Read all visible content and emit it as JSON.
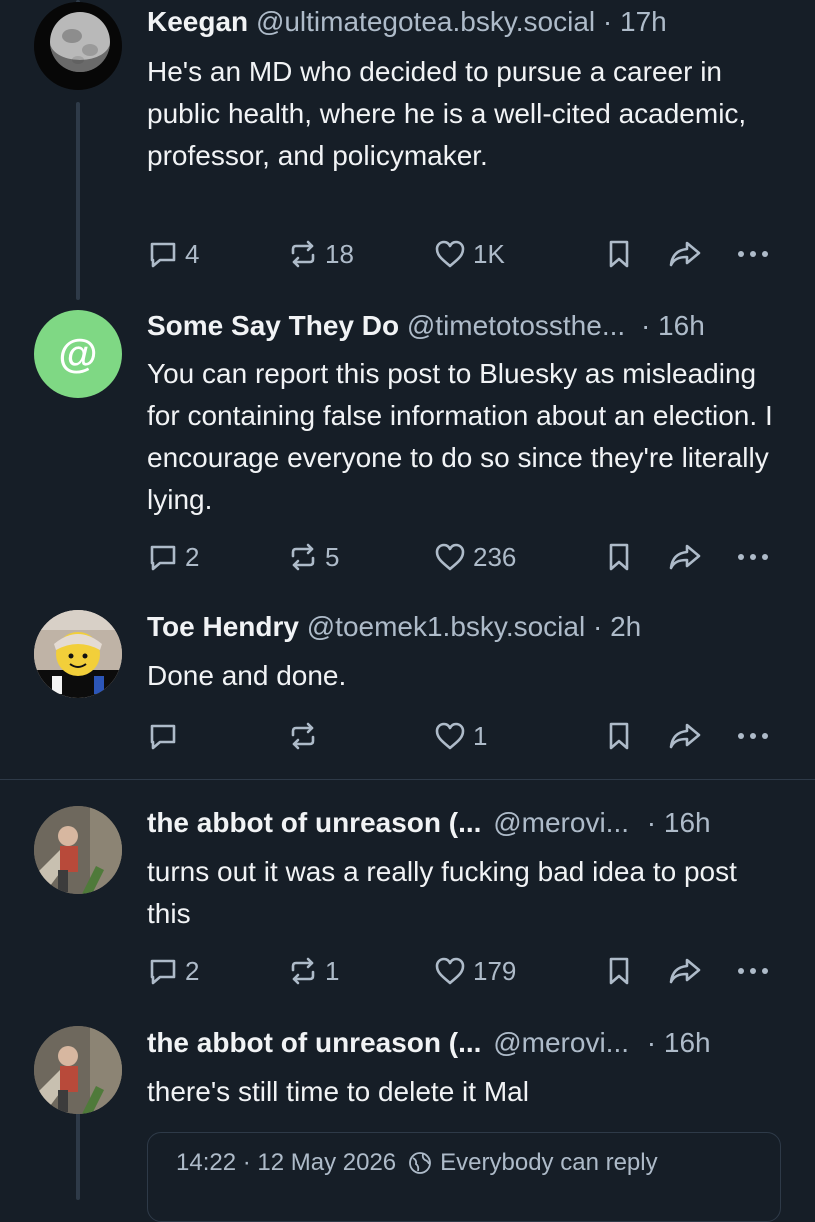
{
  "posts": [
    {
      "name": "Keegan",
      "handle": "@ultimategotea.bsky.social",
      "time": "· 17h",
      "body": "He's an MD who decided to pursue a career in public health, where he is a well-cited academic, professor, and policymaker.",
      "replies": "4",
      "reposts": "18",
      "likes": "1K"
    },
    {
      "name": "Some Say They Do",
      "handle": "@timetotossthe...",
      "time": "· 16h",
      "body": "You can report this post to Bluesky as misleading for containing false information about an election. I encourage everyone to do so since they're literally lying.",
      "replies": "2",
      "reposts": "5",
      "likes": "236",
      "avatar_glyph": "@"
    },
    {
      "name": "Toe Hendry",
      "handle": "@toemek1.bsky.social",
      "time": "· 2h",
      "body": "Done and done.",
      "replies": "",
      "reposts": "",
      "likes": "1"
    },
    {
      "name": "the abbot of unreason (...",
      "handle": "@merovi...",
      "time": "· 16h",
      "body": "turns out it was a really fucking bad idea to post this",
      "replies": "2",
      "reposts": "1",
      "likes": "179"
    },
    {
      "name": "the abbot of unreason (...",
      "handle": "@merovi...",
      "time": "· 16h",
      "body": "there's still time to delete it Mal"
    }
  ],
  "meta": {
    "timestamp": "14:22 · 12 May 2026",
    "reply_setting": "Everybody can reply"
  },
  "icons": {
    "reply": "reply-icon",
    "repost": "repost-icon",
    "like": "heart-icon",
    "bookmark": "bookmark-icon",
    "share": "share-icon",
    "more": "more-icon",
    "globe": "globe-icon"
  },
  "colors": {
    "background": "#161e27",
    "text": "#f1f3f5",
    "muted": "#aebbc9",
    "border": "#2e3a48",
    "avatar_green": "#7fd884"
  }
}
